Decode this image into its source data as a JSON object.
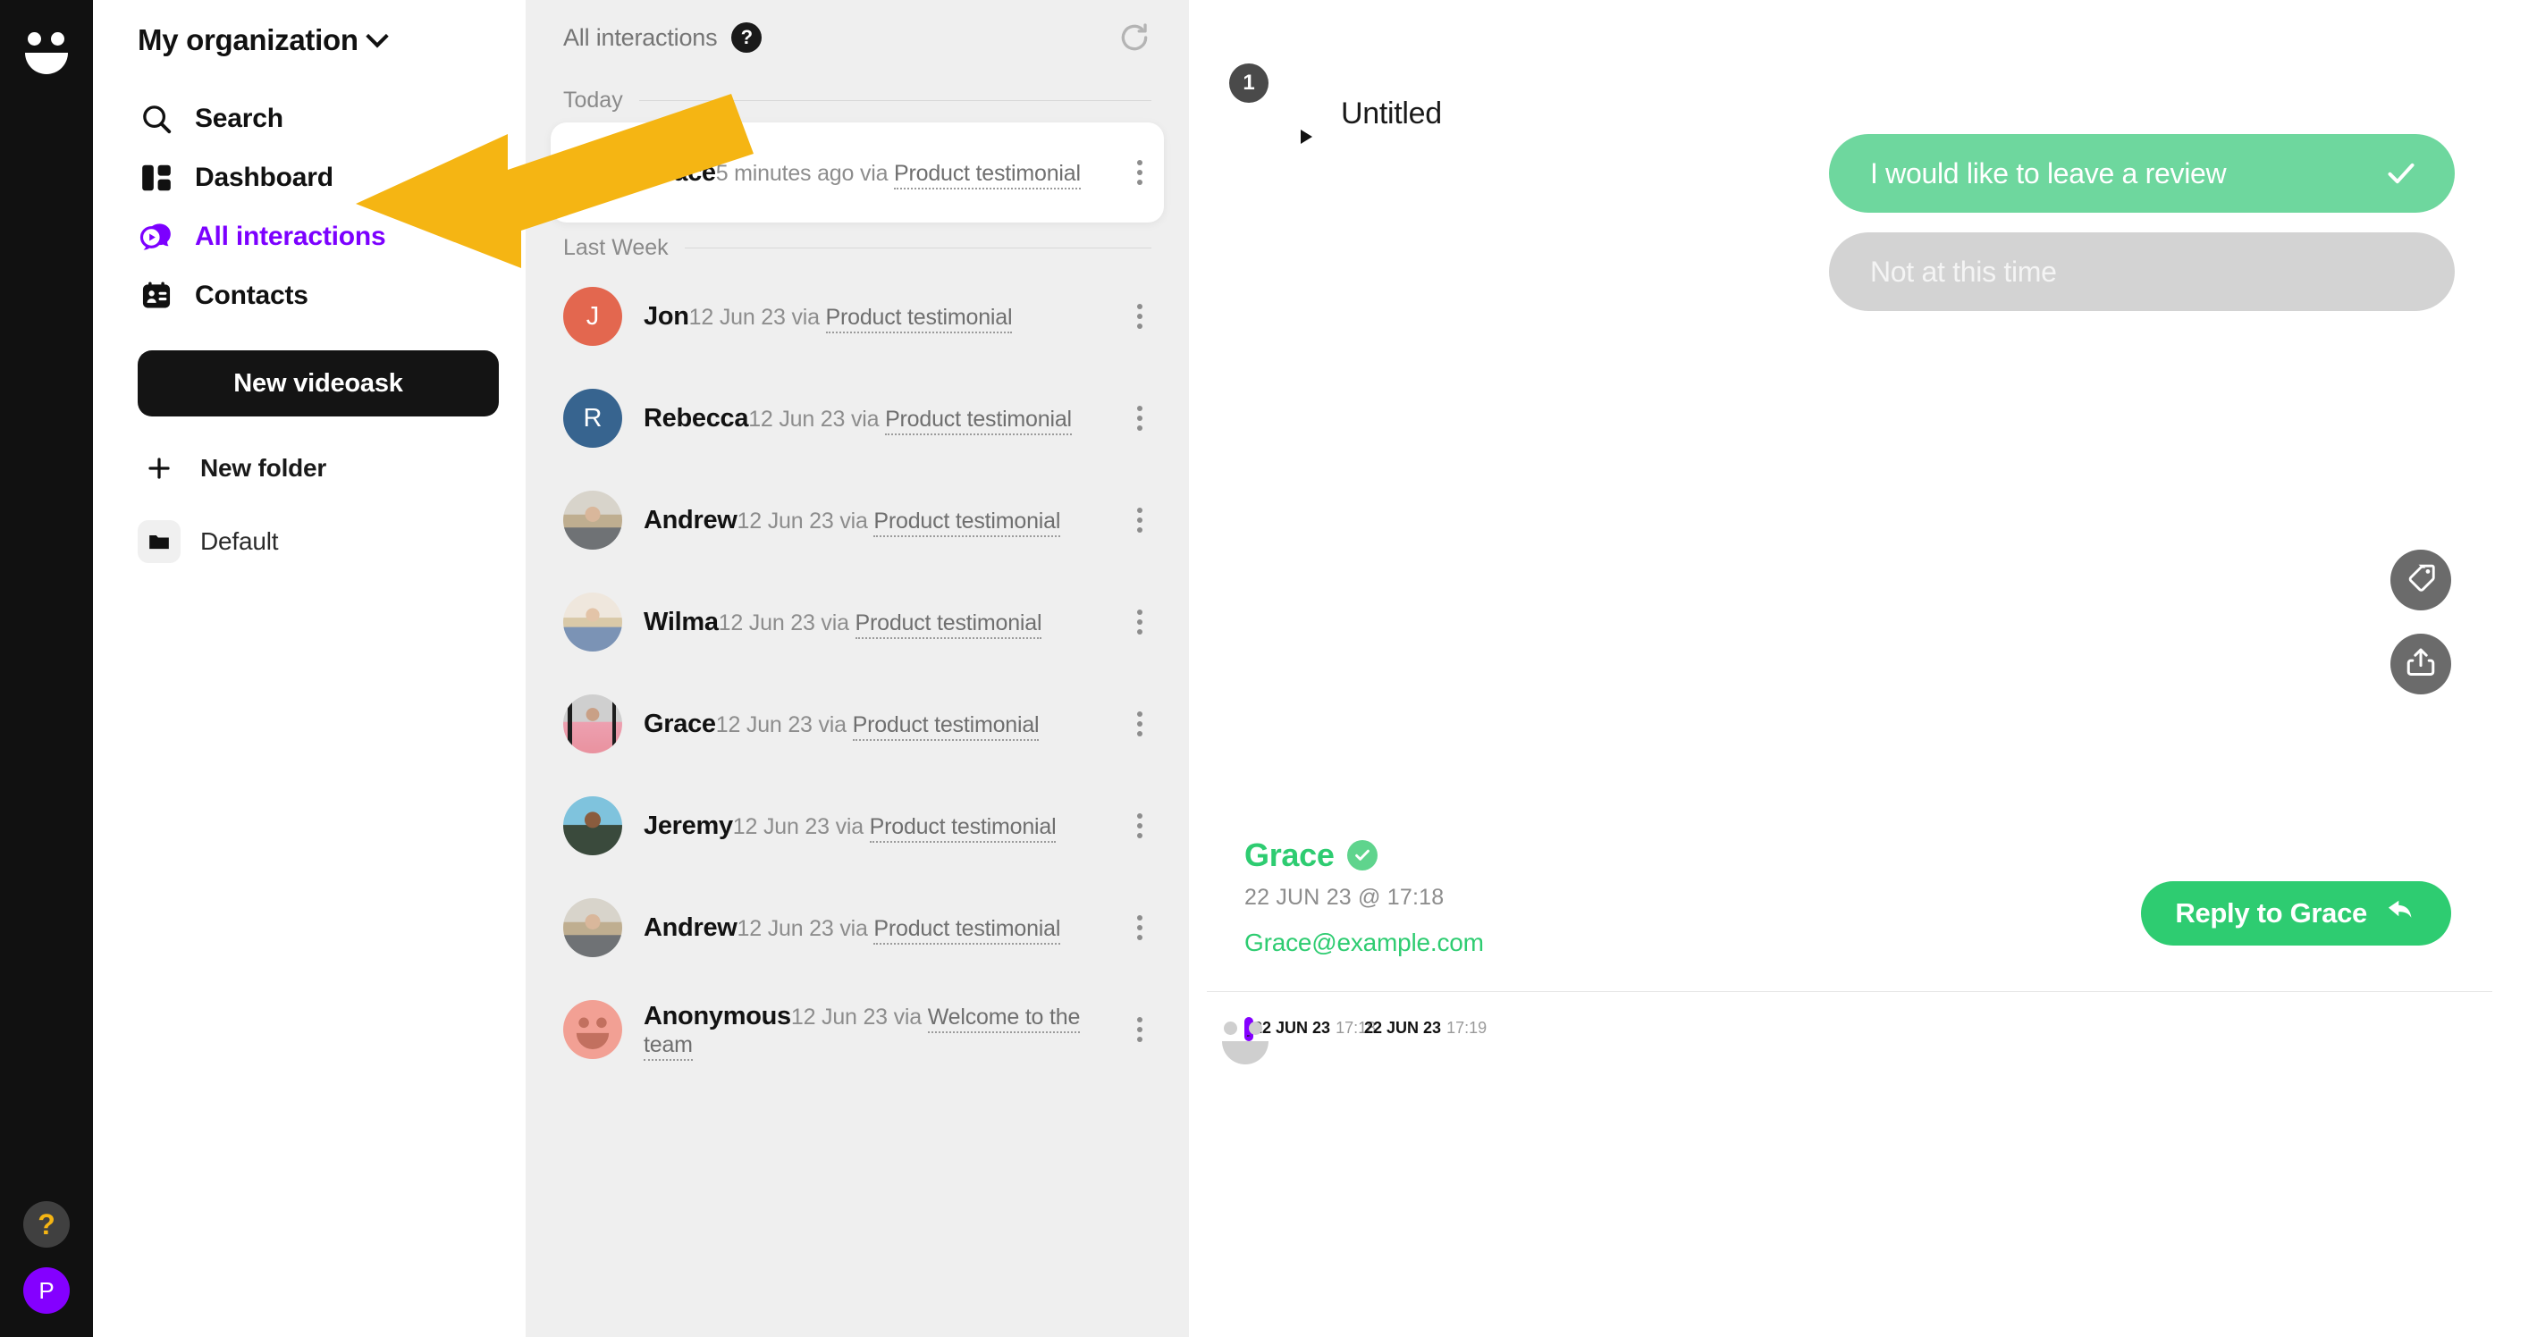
{
  "rail": {
    "logo_icon": "smiley-logo-icon",
    "help_label": "?",
    "avatar_initial": "P"
  },
  "sidebar": {
    "org_title": "My organization",
    "nav_items": [
      {
        "label": "Search",
        "icon": "search-icon",
        "active": false
      },
      {
        "label": "Dashboard",
        "icon": "dashboard-icon",
        "active": false
      },
      {
        "label": "All interactions",
        "icon": "interactions-icon",
        "active": true
      },
      {
        "label": "Contacts",
        "icon": "contacts-icon",
        "active": false
      }
    ],
    "new_videoask_label": "New videoask",
    "new_folder_label": "New folder",
    "folders": [
      {
        "label": "Default",
        "icon": "folder-icon"
      }
    ],
    "active_color": "#7C00FF"
  },
  "list": {
    "title": "All interactions",
    "help_badge": "?",
    "refresh_icon": "refresh-icon",
    "groups": [
      {
        "label": "Today",
        "items": [
          {
            "name": "Grace",
            "time": "5 minutes ago",
            "via": "via",
            "source": "Product testimonial",
            "avatar_kind": "photo",
            "avatar_style": "ph-grace",
            "selected": true
          }
        ]
      },
      {
        "label": "Last Week",
        "items": [
          {
            "name": "Jon",
            "time": "12 Jun 23",
            "via": "via",
            "source": "Product testimonial",
            "avatar_kind": "initial",
            "initial": "J",
            "color": "#E3674F",
            "selected": false
          },
          {
            "name": "Rebecca",
            "time": "12 Jun 23",
            "via": "via",
            "source": "Product testimonial",
            "avatar_kind": "initial",
            "initial": "R",
            "color": "#37648F",
            "selected": false
          },
          {
            "name": "Andrew",
            "time": "12 Jun 23",
            "via": "via",
            "source": "Product testimonial",
            "avatar_kind": "photo",
            "avatar_style": "ph-andrew",
            "selected": false
          },
          {
            "name": "Wilma",
            "time": "12 Jun 23",
            "via": "via",
            "source": "Product testimonial",
            "avatar_kind": "photo",
            "avatar_style": "ph-wilma",
            "selected": false
          },
          {
            "name": "Grace",
            "time": "12 Jun 23",
            "via": "via",
            "source": "Product testimonial",
            "avatar_kind": "photo",
            "avatar_style": "ph-grace",
            "selected": false
          },
          {
            "name": "Jeremy",
            "time": "12 Jun 23",
            "via": "via",
            "source": "Product testimonial",
            "avatar_kind": "photo",
            "avatar_style": "ph-jeremy",
            "selected": false
          },
          {
            "name": "Andrew",
            "time": "12 Jun 23",
            "via": "via",
            "source": "Product testimonial",
            "avatar_kind": "photo",
            "avatar_style": "ph-andrew",
            "selected": false
          },
          {
            "name": "Anonymous",
            "time": "12 Jun 23",
            "via": "via",
            "source": "Welcome to the team",
            "avatar_kind": "smiley",
            "color": "#F2A094",
            "selected": false
          }
        ]
      }
    ]
  },
  "detail": {
    "videoask_title": "Untitled",
    "step_count": "1",
    "play_icon": "play-icon",
    "answers": [
      {
        "text": "I would like to leave a review",
        "chosen": true
      },
      {
        "text": "Not at this time",
        "chosen": false
      }
    ],
    "fabs": [
      {
        "icon": "tag-icon",
        "name": "tag-button"
      },
      {
        "icon": "share-icon",
        "name": "share-button"
      }
    ],
    "contact": {
      "name": "Grace",
      "verified_icon": "verified-check-icon",
      "date": "22 JUN 23 @ 17:18",
      "email": "Grace@example.com"
    },
    "reply_label": "Reply to Grace",
    "reply_icon": "reply-arrow-icon",
    "timeline": [
      {
        "kind": "multiple-choice",
        "date": "22 JUN 23",
        "time": "17:18",
        "active": true
      },
      {
        "kind": "video",
        "date": "22 JUN 23",
        "time": "17:19",
        "active": false
      }
    ],
    "accent_green": "#2ECC71",
    "accent_purple": "#8400FF"
  },
  "annotation": {
    "arrow_color": "#F5B513",
    "arrow_points_to": "Dashboard"
  }
}
